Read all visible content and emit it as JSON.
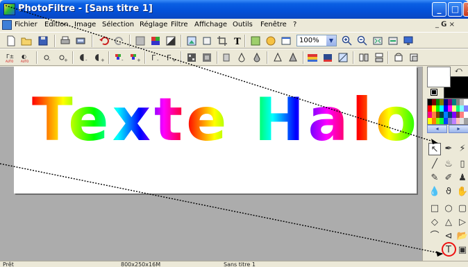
{
  "window": {
    "title": "PhotoFiltre - [Sans titre 1]",
    "minimize_glyph": "_",
    "maximize_glyph": "□",
    "close_glyph": "X"
  },
  "menubar": {
    "items": [
      "Fichier",
      "Edition",
      "Image",
      "Sélection",
      "Réglage",
      "Filtre",
      "Affichage",
      "Outils",
      "Fenêtre",
      "?"
    ],
    "mdi_controls": "_ 𝗚 ×"
  },
  "toolbar": {
    "zoom_value": "100%",
    "zoom_arrow": "▼"
  },
  "canvas": {
    "text": "Texte Halo",
    "halo_gradient": [
      "#ff0000",
      "#ffff00",
      "#00ff00",
      "#00ffff",
      "#0000ff",
      "#ff00ff"
    ]
  },
  "panel": {
    "foreground_color": "#ffffff",
    "background_color": "#000000",
    "palette_colors": [
      "#000000",
      "#800000",
      "#008000",
      "#808000",
      "#000080",
      "#800080",
      "#008080",
      "#808080",
      "#c0c0c0",
      "#ffffff",
      "#ff0000",
      "#ffff00",
      "#00ff00",
      "#00ffff",
      "#0000ff",
      "#ff00ff",
      "#ffff80",
      "#00ff80",
      "#80ffff",
      "#8080ff",
      "#ff0080",
      "#ff8040",
      "#804000",
      "#004040",
      "#0080ff",
      "#004080",
      "#8000ff",
      "#804040",
      "#ff8080",
      "#ffffff",
      "#ffff00",
      "#ff8000",
      "#80ff00",
      "#00ff40",
      "#0040ff",
      "#8080c0",
      "#c080ff",
      "#ffc0c0",
      "#e0e0e0",
      "#a0a0a0"
    ],
    "prev_glyph": "◂",
    "next_glyph": "▸",
    "tools": [
      {
        "name": "selection-tool",
        "glyph": "↖"
      },
      {
        "name": "pipette-tool",
        "glyph": "✒"
      },
      {
        "name": "magic-wand-tool",
        "glyph": "⚡"
      },
      {
        "name": "line-tool",
        "glyph": "╱"
      },
      {
        "name": "fill-tool",
        "glyph": "♨"
      },
      {
        "name": "spray-tool",
        "glyph": "▯"
      },
      {
        "name": "brush-tool",
        "glyph": "✎"
      },
      {
        "name": "advanced-brush-tool",
        "glyph": "✐"
      },
      {
        "name": "stamp-tool",
        "glyph": "♟"
      },
      {
        "name": "blur-tool",
        "glyph": "💧"
      },
      {
        "name": "smudge-tool",
        "glyph": "ϑ"
      },
      {
        "name": "hand-tool",
        "glyph": "✋"
      },
      {
        "name": "rectangle-shape",
        "glyph": "□"
      },
      {
        "name": "ellipse-shape",
        "glyph": "○"
      },
      {
        "name": "rounded-rect-shape",
        "glyph": "▢"
      },
      {
        "name": "diamond-shape",
        "glyph": "◇"
      },
      {
        "name": "triangle-shape",
        "glyph": "△"
      },
      {
        "name": "right-triangle-shape",
        "glyph": "▷"
      },
      {
        "name": "lasso-shape",
        "glyph": "⌒"
      },
      {
        "name": "polygon-shape",
        "glyph": "⊲"
      },
      {
        "name": "open-folder-shape",
        "glyph": "📂"
      },
      {
        "name": "text-tool",
        "glyph": "T"
      },
      {
        "name": "image-tool",
        "glyph": "▣"
      }
    ]
  },
  "statusbar": {
    "state": "Prêt",
    "image_size": "800x250x16M",
    "doc_name": "Sans titre 1"
  },
  "annotation": {
    "highlight_color": "#ee1111"
  }
}
